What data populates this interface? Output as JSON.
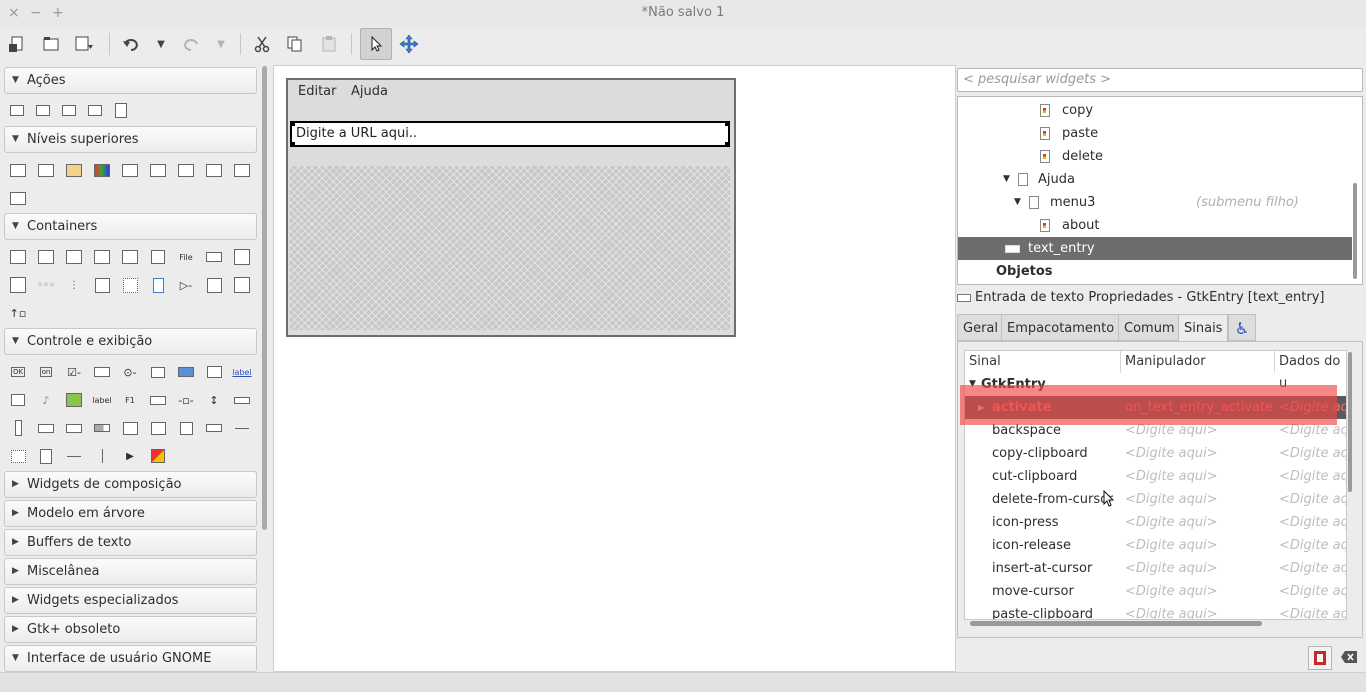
{
  "window": {
    "title": "*Não salvo 1",
    "controls": [
      "×",
      "−",
      "+"
    ]
  },
  "toolbar": {
    "icons": [
      "new-icon",
      "open-icon",
      "save-icon",
      "undo-icon",
      "undo-dropdown-icon",
      "redo-icon",
      "redo-dropdown-icon",
      "cut-icon",
      "copy-icon",
      "paste-icon",
      "select-pointer-icon",
      "drag-resize-icon"
    ]
  },
  "palette": {
    "categories": [
      {
        "label": "Ações",
        "expanded": true
      },
      {
        "label": "Níveis superiores",
        "expanded": true
      },
      {
        "label": "Containers",
        "expanded": true
      },
      {
        "label": "Controle e exibição",
        "expanded": true
      },
      {
        "label": "Widgets de composição",
        "expanded": false
      },
      {
        "label": "Modelo em árvore",
        "expanded": false
      },
      {
        "label": "Buffers de texto",
        "expanded": false
      },
      {
        "label": "Miscelânea",
        "expanded": false
      },
      {
        "label": "Widgets especializados",
        "expanded": false
      },
      {
        "label": "Gtk+ obsoleto",
        "expanded": false
      },
      {
        "label": "Interface de usuário GNOME",
        "expanded": true
      }
    ],
    "icon_labels": {
      "file": "File",
      "label1": "label",
      "label2": "label",
      "f1": "F1",
      "ok": "OK",
      "on": "on",
      "label_blue": "label"
    }
  },
  "preview": {
    "menu": [
      "Editar",
      "Ajuda"
    ],
    "entry_text": "Digite a URL aqui.."
  },
  "search": {
    "placeholder": "< pesquisar widgets >"
  },
  "tree": {
    "rows": [
      {
        "label": "copy",
        "note": ""
      },
      {
        "label": "paste",
        "note": ""
      },
      {
        "label": "delete",
        "note": ""
      },
      {
        "label": "Ajuda",
        "note": ""
      },
      {
        "label": "menu3",
        "note": "(submenu filho)"
      },
      {
        "label": "about",
        "note": ""
      },
      {
        "label": "text_entry",
        "note": ""
      },
      {
        "label": "Objetos",
        "note": ""
      }
    ]
  },
  "properties": {
    "title": "Entrada de texto Propriedades - GtkEntry [text_entry]",
    "tabs": [
      "Geral",
      "Empacotamento",
      "Comum",
      "Sinais"
    ],
    "active_tab": "Sinais"
  },
  "signals": {
    "headers": [
      "Sinal",
      "Manipulador",
      "Dados do u"
    ],
    "group": "GtkEntry",
    "rows": [
      {
        "signal": "activate",
        "handler": "on_text_entry_activate",
        "data": "<Digite aq"
      },
      {
        "signal": "backspace",
        "handler": "<Digite aqui>",
        "data": "<Digite aq"
      },
      {
        "signal": "copy-clipboard",
        "handler": "<Digite aqui>",
        "data": "<Digite aq"
      },
      {
        "signal": "cut-clipboard",
        "handler": "<Digite aqui>",
        "data": "<Digite aq"
      },
      {
        "signal": "delete-from-cursor",
        "handler": "<Digite aqui>",
        "data": "<Digite aq"
      },
      {
        "signal": "icon-press",
        "handler": "<Digite aqui>",
        "data": "<Digite aq"
      },
      {
        "signal": "icon-release",
        "handler": "<Digite aqui>",
        "data": "<Digite aq"
      },
      {
        "signal": "insert-at-cursor",
        "handler": "<Digite aqui>",
        "data": "<Digite aq"
      },
      {
        "signal": "move-cursor",
        "handler": "<Digite aqui>",
        "data": "<Digite aq"
      },
      {
        "signal": "paste-clipboard",
        "handler": "<Digite aqui>",
        "data": "<Digite aq"
      }
    ]
  },
  "colors": {
    "highlight": "#f04646",
    "selected_row": "#6d6d6d",
    "activate_text": "#f07070"
  }
}
